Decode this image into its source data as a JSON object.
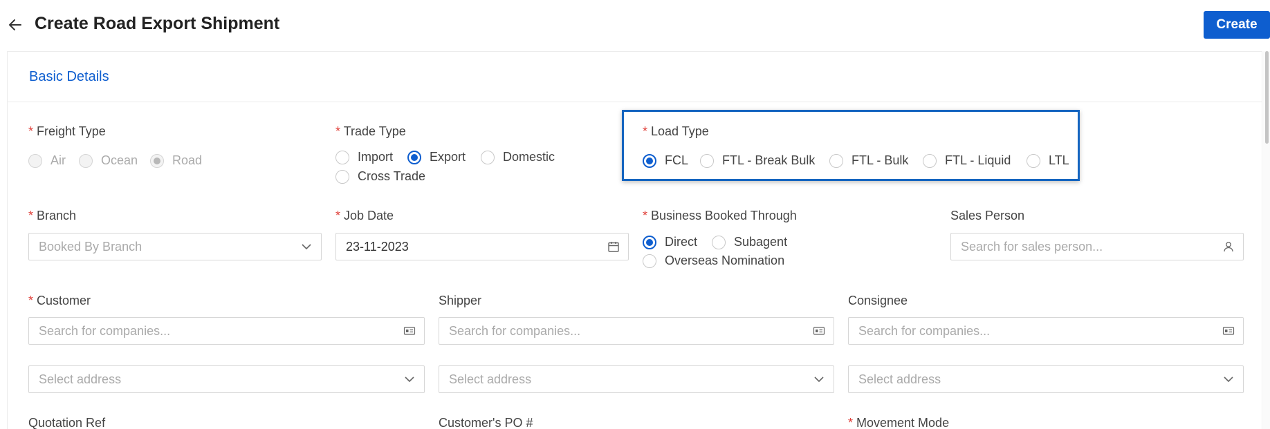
{
  "header": {
    "title": "Create Road Export Shipment",
    "create_label": "Create"
  },
  "section": {
    "title": "Basic Details"
  },
  "freight_type": {
    "label": "Freight Type",
    "options": [
      "Air",
      "Ocean",
      "Road"
    ],
    "selected": "Road"
  },
  "trade_type": {
    "label": "Trade Type",
    "options": [
      "Import",
      "Export",
      "Domestic",
      "Cross Trade"
    ],
    "selected": "Export"
  },
  "load_type": {
    "label": "Load Type",
    "options": [
      "FCL",
      "FTL - Break Bulk",
      "FTL - Bulk",
      "FTL - Liquid",
      "LTL"
    ],
    "selected": "FCL"
  },
  "branch": {
    "label": "Branch",
    "placeholder": "Booked By Branch"
  },
  "job_date": {
    "label": "Job Date",
    "value": "23-11-2023"
  },
  "business_booked": {
    "label": "Business Booked Through",
    "options": [
      "Direct",
      "Subagent",
      "Overseas Nomination"
    ],
    "selected": "Direct"
  },
  "sales_person": {
    "label": "Sales Person",
    "placeholder": "Search for sales person..."
  },
  "customer": {
    "label": "Customer",
    "placeholder": "Search for companies...",
    "address_placeholder": "Select address"
  },
  "shipper": {
    "label": "Shipper",
    "placeholder": "Search for companies...",
    "address_placeholder": "Select address"
  },
  "consignee": {
    "label": "Consignee",
    "placeholder": "Search for companies...",
    "address_placeholder": "Select address"
  },
  "quotation_ref": {
    "label": "Quotation Ref"
  },
  "customer_po": {
    "label": "Customer's PO #"
  },
  "movement_mode": {
    "label": "Movement Mode"
  },
  "colors": {
    "accent": "#0e5ecf",
    "required": "#e0403a",
    "highlight": "#1565c0"
  }
}
